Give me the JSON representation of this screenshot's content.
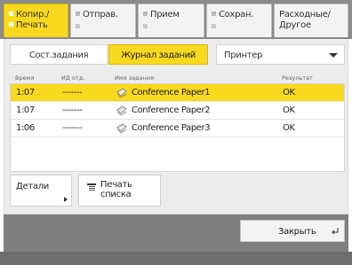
{
  "tabs": [
    {
      "line1": "Копир./",
      "line2": "Печать",
      "active": true
    },
    {
      "line1": "Отправ.",
      "line2": "",
      "active": false
    },
    {
      "line1": "Прием",
      "line2": "",
      "active": false
    },
    {
      "line1": "Сохран.",
      "line2": "",
      "active": false
    },
    {
      "line1": "Расходные/",
      "line2": "Другое",
      "active": false
    }
  ],
  "view_tabs": {
    "status_label": "Сост.задания",
    "log_label": "Журнал заданий"
  },
  "device_select": {
    "value": "Принтер"
  },
  "table": {
    "headers": {
      "time": "Время",
      "id": "ИД отд.",
      "name": "Имя задания",
      "result": "Результат"
    },
    "rows": [
      {
        "time": "1:07",
        "id": "-------",
        "name": "Conference Paper1",
        "result": "OK",
        "selected": true,
        "icon": "document-icon"
      },
      {
        "time": "1:07",
        "id": "-------",
        "name": "Conference Paper2",
        "result": "OK",
        "selected": false,
        "icon": "document-icon"
      },
      {
        "time": "1:06",
        "id": "-------",
        "name": "Conference Paper3",
        "result": "OK",
        "selected": false,
        "icon": "document-icon"
      }
    ]
  },
  "actions": {
    "details_label": "Детали",
    "print_list_label1": "Печать",
    "print_list_label2": "списка"
  },
  "footer": {
    "close_label": "Закрыть"
  },
  "colors": {
    "accent": "#f8d91e",
    "header_bg": "#8b8b8b",
    "footer_bg": "#7f7f7f"
  }
}
